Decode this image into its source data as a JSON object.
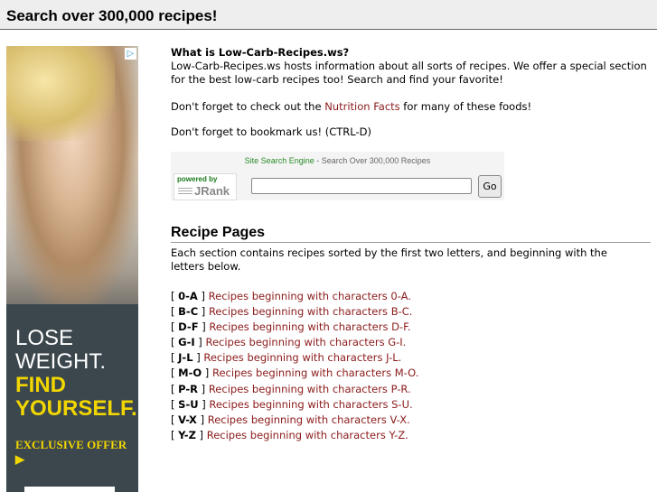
{
  "header": {
    "title": "Search over 300,000 recipes!"
  },
  "ad": {
    "choice_icon": "adchoices-icon",
    "line1": "LOSE",
    "line2": "WEIGHT.",
    "line3": "FIND",
    "line4": "YOURSELF.",
    "offer": "EXCLUSIVE OFFER ▶"
  },
  "intro": {
    "question": "What is Low-Carb-Recipes.ws?",
    "text": "Low-Carb-Recipes.ws hosts information about all sorts of recipes. We offer a special section for the best low-carb recipes too! Search and find your favorite!",
    "nutrition_prefix": "Don't forget to check out the ",
    "nutrition_link": "Nutrition Facts",
    "nutrition_suffix": " for many of these foods!",
    "bookmark": "Don't forget to bookmark us! (CTRL-D)"
  },
  "search": {
    "engine_link": "Site Search Engine",
    "engine_suffix": " - Search Over 300,000 Recipes",
    "powered_by": "powered by",
    "brand": "JRank",
    "input_value": "",
    "go_label": "Go"
  },
  "recipe_pages": {
    "heading": "Recipe Pages",
    "description": "Each section contains recipes sorted by the first two letters, and beginning with the letters below.",
    "items": [
      {
        "range": "0-A",
        "link": "Recipes beginning with characters 0-A."
      },
      {
        "range": "B-C",
        "link": "Recipes beginning with characters B-C."
      },
      {
        "range": "D-F",
        "link": "Recipes beginning with characters D-F."
      },
      {
        "range": "G-I",
        "link": "Recipes beginning with characters G-I."
      },
      {
        "range": "J-L",
        "link": "Recipes beginning with characters J-L."
      },
      {
        "range": "M-O",
        "link": "Recipes beginning with characters M-O."
      },
      {
        "range": "P-R",
        "link": "Recipes beginning with characters P-R."
      },
      {
        "range": "S-U",
        "link": "Recipes beginning with characters S-U."
      },
      {
        "range": "V-X",
        "link": "Recipes beginning with characters V-X."
      },
      {
        "range": "Y-Z",
        "link": "Recipes beginning with characters Y-Z."
      }
    ]
  }
}
